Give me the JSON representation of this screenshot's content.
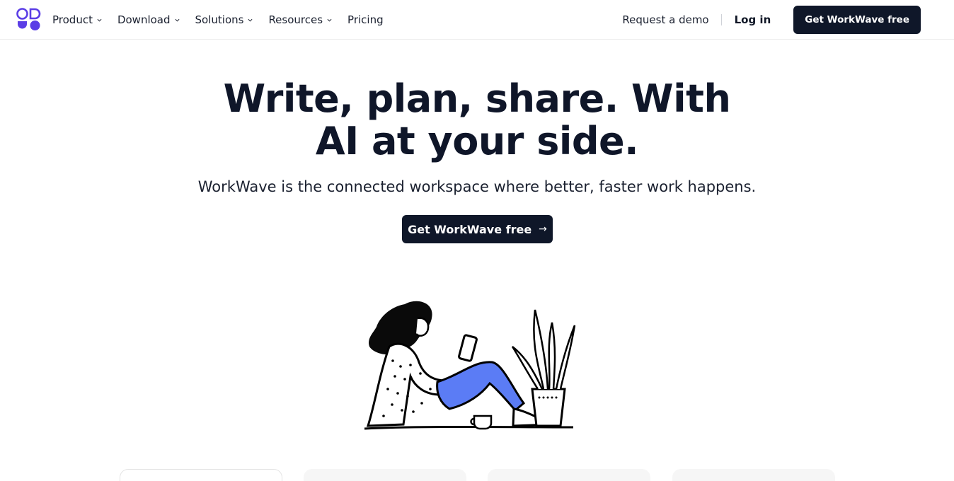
{
  "nav": {
    "logo_name": "workwave-logo",
    "items": [
      {
        "label": "Product",
        "has_dropdown": true
      },
      {
        "label": "Download",
        "has_dropdown": true
      },
      {
        "label": "Solutions",
        "has_dropdown": true
      },
      {
        "label": "Resources",
        "has_dropdown": true
      },
      {
        "label": "Pricing",
        "has_dropdown": false
      }
    ],
    "request_demo": "Request a demo",
    "login": "Log in",
    "cta": "Get WorkWave free"
  },
  "hero": {
    "title_line1": "Write, plan, share. With",
    "title_line2": "AI at your side.",
    "subtitle": "WorkWave is the connected workspace where better, faster work happens.",
    "cta": "Get WorkWave free",
    "cta_icon": "arrow-right-icon"
  },
  "colors": {
    "brand_dark": "#0f1729",
    "logo_purple": "#5b3ee6",
    "illustration_blue": "#5b7cf5"
  }
}
